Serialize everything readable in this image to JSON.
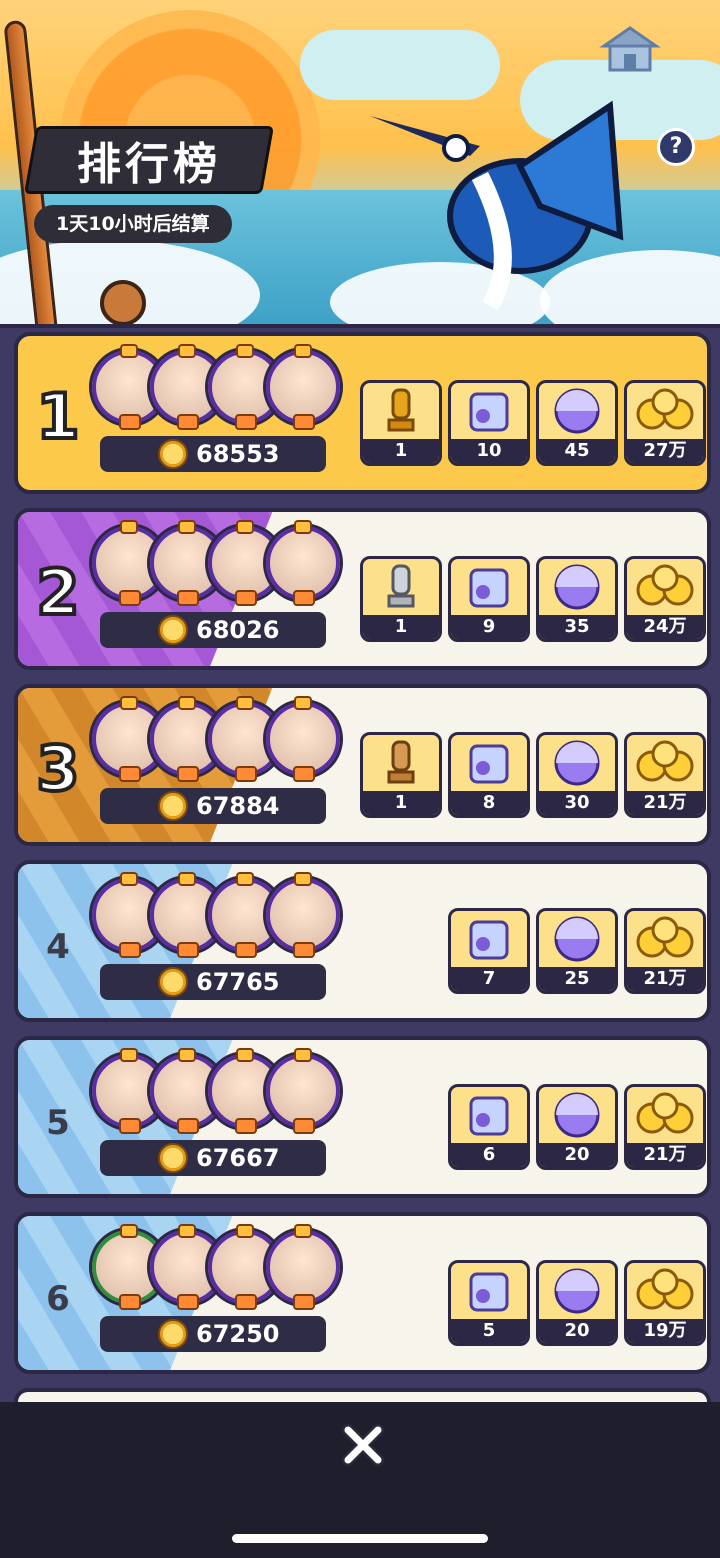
{
  "header": {
    "title": "排行榜",
    "countdown": "1天10小时后结算",
    "help_label": "?"
  },
  "rows": [
    {
      "rank": "1",
      "score": "68553",
      "rewards": [
        "1",
        "10",
        "45",
        "27万"
      ],
      "trophy": "gold-trophy"
    },
    {
      "rank": "2",
      "score": "68026",
      "rewards": [
        "1",
        "9",
        "35",
        "24万"
      ],
      "trophy": "silver-trophy"
    },
    {
      "rank": "3",
      "score": "67884",
      "rewards": [
        "1",
        "8",
        "30",
        "21万"
      ],
      "trophy": "bronze-trophy"
    },
    {
      "rank": "4",
      "score": "67765",
      "rewards": [
        "7",
        "25",
        "21万"
      ]
    },
    {
      "rank": "5",
      "score": "67667",
      "rewards": [
        "6",
        "20",
        "21万"
      ]
    },
    {
      "rank": "6",
      "score": "67250",
      "rewards": [
        "5",
        "20",
        "19万"
      ]
    }
  ],
  "icons": {
    "close": "close-icon",
    "coin": "coin-icon",
    "mystery_box": "mystery-box-icon",
    "capsule": "capsule-icon",
    "gold_pile": "gold-pile-icon"
  },
  "colors": {
    "first_place_card": "#fcc94a",
    "second_place_stripe": "#b76be0",
    "third_place_stripe": "#e49c3b",
    "other_stripe": "#a9d4f2",
    "panel_bg": "#3f3a63"
  }
}
